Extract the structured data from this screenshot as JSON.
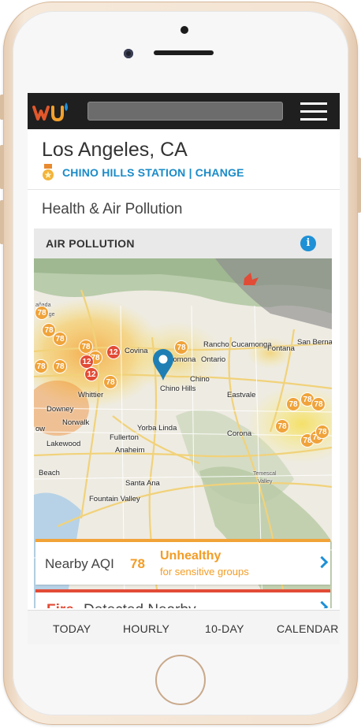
{
  "app": {
    "logo_text": "wu"
  },
  "search": {
    "value": ""
  },
  "location": {
    "title": "Los Angeles, CA"
  },
  "station": {
    "label": "CHINO HILLS STATION | CHANGE"
  },
  "section": {
    "title": "Health & Air Pollution"
  },
  "air_pollution": {
    "title": "AIR POLLUTION",
    "info_icon": "i",
    "map_labels": {
      "canada": "añada",
      "flintridge": "lintridge",
      "covina": "Covina",
      "pomona": "Pomona",
      "rancho": "Rancho Cucamonga",
      "fontana": "Fontana",
      "san_bernardino": "San Berna",
      "ontario": "Ontario",
      "chino": "Chino",
      "chino_hills": "Chino Hills",
      "whittier": "Whittier",
      "eastvale": "Eastvale",
      "downey": "Downey",
      "norwalk": "Norwalk",
      "torrance_tow": "ow",
      "fullerton": "Fullerton",
      "yorba_linda": "Yorba Linda",
      "corona": "Corona",
      "lakewood": "Lakewood",
      "anaheim": "Anaheim",
      "beach": "Beach",
      "santa_ana": "Santa Ana",
      "fountain_valley": "Fountain Valley",
      "temescal": "Temescal",
      "valley": "Valley"
    },
    "aqi_readings": [
      "78",
      "78",
      "78",
      "78",
      "12",
      "12",
      "12",
      "78",
      "78",
      "78",
      "78",
      "78",
      "78",
      "78",
      "78",
      "78",
      "78",
      "78",
      "78"
    ],
    "nearby_aqi": {
      "label": "Nearby AQI",
      "value": "78",
      "status": "Unhealthy",
      "subtext": "for sensitive groups"
    },
    "fire": {
      "highlight": "Fire",
      "rest": "Detected Nearby"
    }
  },
  "tabs": [
    {
      "label": "TODAY"
    },
    {
      "label": "HOURLY"
    },
    {
      "label": "10-DAY"
    },
    {
      "label": "CALENDAR"
    }
  ]
}
